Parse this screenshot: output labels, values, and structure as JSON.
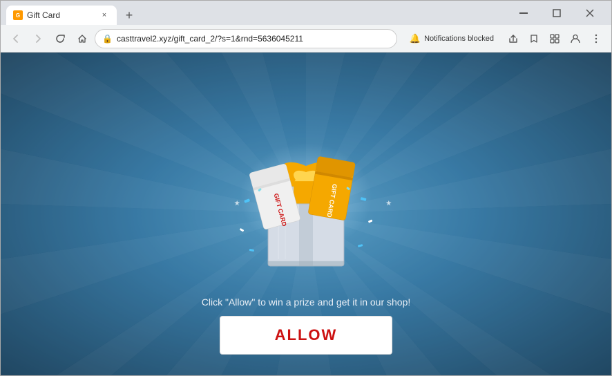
{
  "browser": {
    "tab": {
      "favicon_label": "G",
      "title": "Gift Card",
      "close_label": "×"
    },
    "new_tab_label": "+",
    "window_controls": {
      "minimize": "—",
      "maximize": "□",
      "close": "✕"
    },
    "nav": {
      "back": "←",
      "forward": "→",
      "refresh": "↻",
      "home": "⌂"
    },
    "address_bar": {
      "url": "casttravel2.xyz/gift_card_2/?s=1&rnd=5636045211",
      "lock_icon": "🔒"
    },
    "notification_blocked_label": "Notifications blocked",
    "toolbar_icons": {
      "share": "↗",
      "bookmark": "☆",
      "puzzle": "🧩",
      "profile": "👤",
      "menu": "⋮"
    }
  },
  "page": {
    "cta_text": "Click \"Allow\" to win a prize and get it in our shop!",
    "allow_button_label": "ALLOW",
    "gift_cards": [
      {
        "label": "GIFT CARD",
        "color": "#f5f5f5"
      },
      {
        "label": "GIFT CARD",
        "color": "#f5a800"
      }
    ]
  }
}
